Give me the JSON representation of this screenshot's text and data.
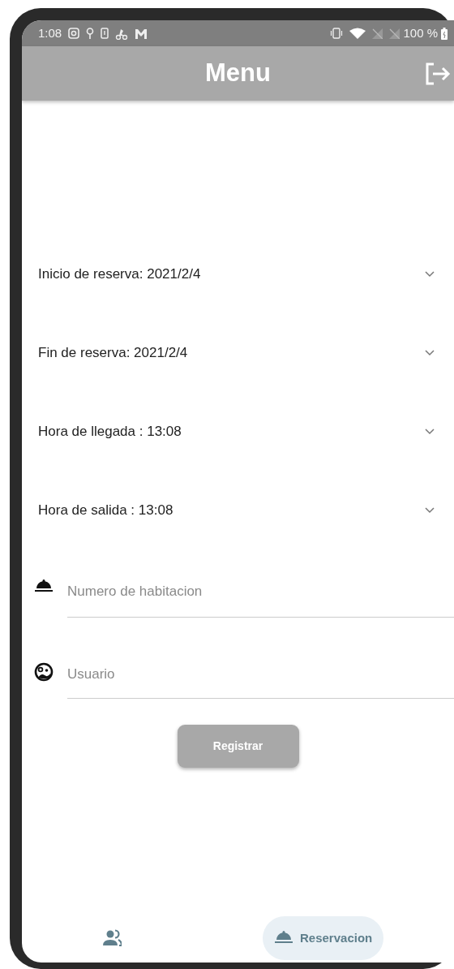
{
  "status_bar": {
    "time": "1:08",
    "battery": "100 %"
  },
  "app_bar": {
    "title": "Menu"
  },
  "pickers": [
    {
      "label": "Inicio de reserva:  2021/2/4"
    },
    {
      "label": "Fin de reserva:  2021/2/4"
    },
    {
      "label": "Hora de llegada :  13:08"
    },
    {
      "label": "Hora de salida :  13:08"
    }
  ],
  "fields": [
    {
      "kind": "room",
      "placeholder": "Numero de habitacion"
    },
    {
      "kind": "user",
      "placeholder": "Usuario"
    }
  ],
  "button": {
    "label": "Registrar"
  },
  "bottom_nav": [
    {
      "kind": "people",
      "selected": false
    },
    {
      "kind": "room",
      "label": "Reservacion",
      "selected": true
    }
  ]
}
